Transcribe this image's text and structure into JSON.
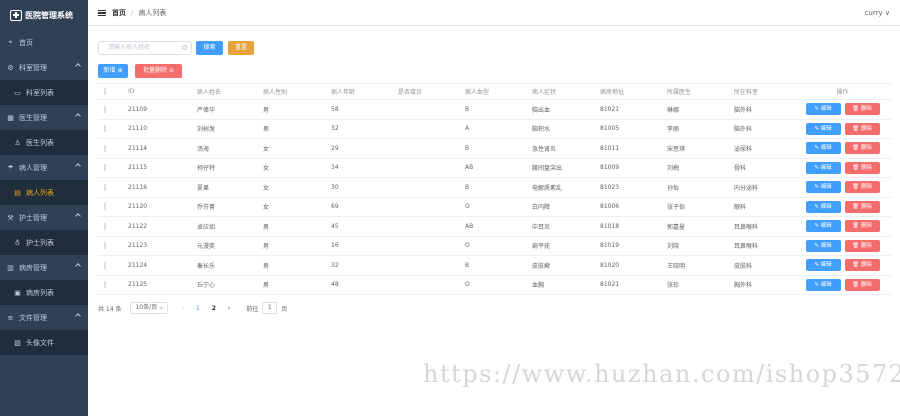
{
  "app": {
    "title": "医院管理系统"
  },
  "sidebar": {
    "items": [
      {
        "label": "首页",
        "icon": "location-icon",
        "type": "top"
      },
      {
        "label": "科室管理",
        "icon": "gear-icon",
        "type": "group"
      },
      {
        "label": "科室列表",
        "icon": "monitor-icon",
        "type": "sub"
      },
      {
        "label": "医生管理",
        "icon": "grid-icon",
        "type": "group"
      },
      {
        "label": "医生列表",
        "icon": "user-icon",
        "type": "sub"
      },
      {
        "label": "病人管理",
        "icon": "umbrella-icon",
        "type": "group"
      },
      {
        "label": "病人列表",
        "icon": "folder-icon",
        "type": "sub",
        "active": true
      },
      {
        "label": "护士管理",
        "icon": "tools-icon",
        "type": "group"
      },
      {
        "label": "护士列表",
        "icon": "bulb-icon",
        "type": "sub"
      },
      {
        "label": "病房管理",
        "icon": "building-icon",
        "type": "group"
      },
      {
        "label": "病房列表",
        "icon": "document-icon",
        "type": "sub"
      },
      {
        "label": "文件管理",
        "icon": "menu-icon",
        "type": "group"
      },
      {
        "label": "头像文件",
        "icon": "image-icon",
        "type": "sub"
      }
    ]
  },
  "header": {
    "breadcrumb_home": "首页",
    "breadcrumb_sep": "/",
    "breadcrumb_current": "病人列表",
    "user": "curry ∨"
  },
  "toolbar": {
    "search_placeholder": "请输入病人姓名",
    "search_label": "搜索",
    "reset_label": "重置",
    "add_label": "新增 ⊕",
    "batch_delete_label": "批量删除 ⊖"
  },
  "table": {
    "columns": [
      "",
      "ID",
      "病人姓名",
      "病人性别",
      "病人年龄",
      "是否接诊",
      "病人血型",
      "病人症状",
      "病房地址",
      "所属医生",
      "所在科室",
      "操作"
    ],
    "edit_label": "✎ 编辑",
    "delete_label": "🗑 删除",
    "rows": [
      {
        "id": "21109",
        "name": "严偉华",
        "sex": "男",
        "age": "58",
        "received": true,
        "blood": "B",
        "symptom": "脑出血",
        "ward": "81021",
        "doctor": "琳娜",
        "dept": "脑外科"
      },
      {
        "id": "21110",
        "name": "刘树发",
        "sex": "男",
        "age": "32",
        "received": false,
        "blood": "A",
        "symptom": "脑积水",
        "ward": "81005",
        "doctor": "李丽",
        "dept": "脑外科"
      },
      {
        "id": "21114",
        "name": "汤海",
        "sex": "女",
        "age": "29",
        "received": true,
        "blood": "B",
        "symptom": "急性肾炎",
        "ward": "81011",
        "doctor": "宋思琪",
        "dept": "泌尿科"
      },
      {
        "id": "21115",
        "name": "柯仔特",
        "sex": "女",
        "age": "34",
        "received": true,
        "blood": "AB",
        "symptom": "腰间盘突出",
        "ward": "81009",
        "doctor": "刘梅",
        "dept": "骨科"
      },
      {
        "id": "21116",
        "name": "夏果",
        "sex": "女",
        "age": "30",
        "received": false,
        "blood": "B",
        "symptom": "电解质紊乱",
        "ward": "81023",
        "doctor": "孙怡",
        "dept": "内分泌科"
      },
      {
        "id": "21120",
        "name": "乔芬菁",
        "sex": "女",
        "age": "69",
        "received": true,
        "blood": "O",
        "symptom": "白内障",
        "ward": "81006",
        "doctor": "张子怡",
        "dept": "眼科"
      },
      {
        "id": "21122",
        "name": "卓应如",
        "sex": "男",
        "age": "45",
        "received": false,
        "blood": "AB",
        "symptom": "中耳炎",
        "ward": "81018",
        "doctor": "郭嘉曼",
        "dept": "耳鼻喉科"
      },
      {
        "id": "21123",
        "name": "元漫奕",
        "sex": "男",
        "age": "16",
        "received": true,
        "blood": "O",
        "symptom": "扁平疣",
        "ward": "81019",
        "doctor": "刘晓",
        "dept": "耳鼻喉科"
      },
      {
        "id": "21124",
        "name": "秦长乐",
        "sex": "男",
        "age": "32",
        "received": false,
        "blood": "B",
        "symptom": "皮肤癣",
        "ward": "81020",
        "doctor": "王晓明",
        "dept": "皮肤科"
      },
      {
        "id": "21125",
        "name": "丘宁心",
        "sex": "男",
        "age": "48",
        "received": false,
        "blood": "O",
        "symptom": "血胸",
        "ward": "81021",
        "doctor": "张珍",
        "dept": "胸外科"
      }
    ]
  },
  "pagination": {
    "total": "共 14 条",
    "page_size": "10条/页",
    "prev": "‹",
    "page1": "1",
    "page2": "2",
    "next": "›",
    "goto_label": "前往",
    "goto_value": "1",
    "page_suffix": "页"
  },
  "watermark": "https://www.huzhan.com/ishop3572"
}
